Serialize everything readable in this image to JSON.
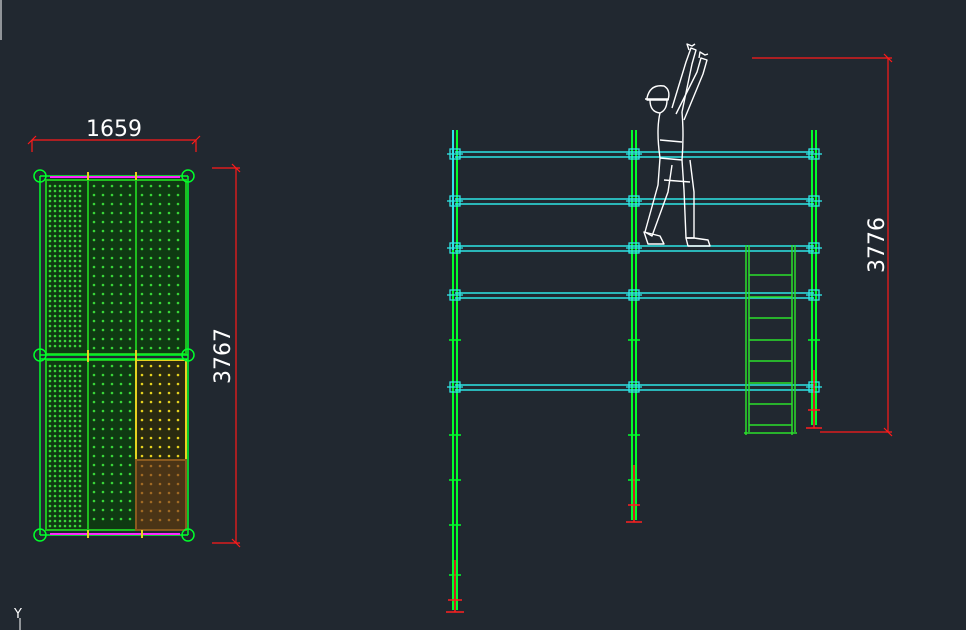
{
  "colors": {
    "background": "#212830",
    "dimension": "#ff1a1a",
    "dimension_text": "#ffffff",
    "frame": "#00ff2a",
    "ledger": "#2ee6e6",
    "plank_green": "#1fbf1f",
    "plank_yellow": "#e6d21f",
    "plank_brown": "#8a5a1e",
    "ladder": "#2adf2a",
    "base_jack": "#ff2020",
    "figure": "#ffffff",
    "toeboard": "#ff2bff"
  },
  "plan_view": {
    "width_dimension": "1659",
    "height_dimension": "3767"
  },
  "elevation_view": {
    "height_dimension": "3776"
  },
  "ucs": {
    "axis_label": "Y"
  },
  "icons": [
    "worker-figure-icon",
    "ladder-icon",
    "ucs-icon"
  ]
}
